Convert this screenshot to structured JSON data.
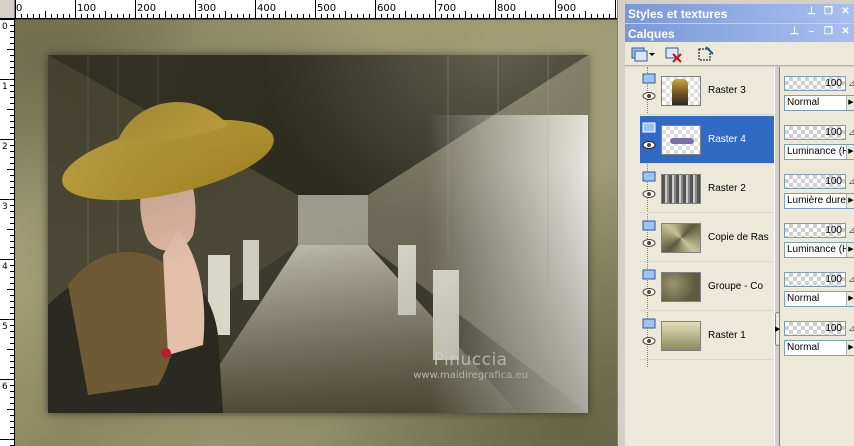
{
  "ruler": {
    "top_labels": [
      "0",
      "100",
      "200",
      "300",
      "400",
      "500",
      "600",
      "700",
      "800",
      "900"
    ],
    "left_labels": [
      "0",
      "1",
      "2",
      "3",
      "4",
      "5",
      "6"
    ]
  },
  "canvas": {
    "watermark_line1": "Pinuccia",
    "watermark_line2": "www.maidiregrafica.eu"
  },
  "panel": {
    "styles_title": "Styles et textures",
    "layers_title": "Calques",
    "title_buttons": [
      "pin-icon",
      "restore-icon",
      "close-icon"
    ]
  },
  "layers": [
    {
      "name": "Raster 3",
      "opacity": "100",
      "blend": "Normal",
      "selected": false
    },
    {
      "name": "Raster 4",
      "opacity": "100",
      "blend": "Luminance (H)",
      "selected": true
    },
    {
      "name": "Raster 2",
      "opacity": "100",
      "blend": "Lumière dure",
      "selected": false
    },
    {
      "name": "Copie de Ras",
      "opacity": "100",
      "blend": "Luminance (H)",
      "selected": false
    },
    {
      "name": "Groupe - Co",
      "opacity": "100",
      "blend": "Normal",
      "selected": false
    },
    {
      "name": "Raster 1",
      "opacity": "100",
      "blend": "Normal",
      "selected": false
    }
  ],
  "colors": {
    "selection": "#316ac5",
    "titlebar": "#7a98d6",
    "accent_hat": "#c9a83b"
  }
}
